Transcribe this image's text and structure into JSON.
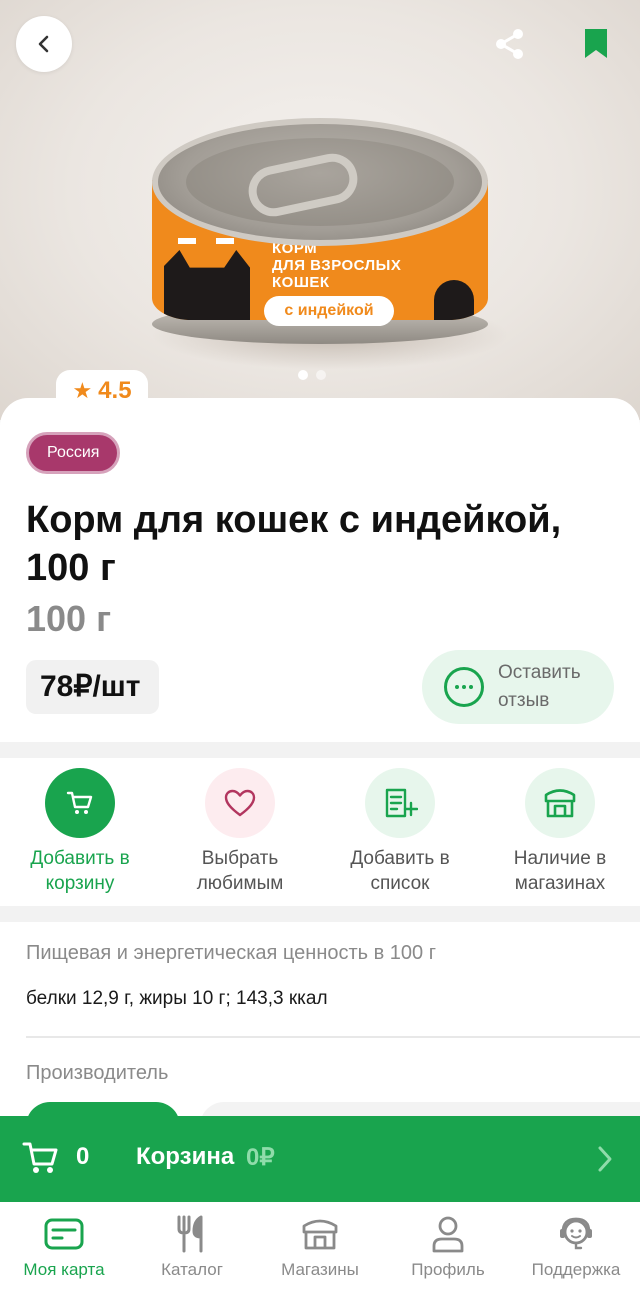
{
  "product": {
    "rating": "4.5",
    "origin_badge": "Россия",
    "title": "Корм для кошек с индейкой, 100 г",
    "weight": "100 г",
    "price": "78₽/шт",
    "review_button": "Оставить отзыв",
    "image_dots": {
      "total": 2,
      "active_index": 0
    }
  },
  "can_label": {
    "lines": [
      "КОРМ",
      "ДЛЯ ВЗРОСЛЫХ",
      "КОШЕК"
    ],
    "pill": "с индейкой"
  },
  "actions": [
    {
      "label": "Добавить в корзину",
      "icon": "cart-icon"
    },
    {
      "label": "Выбрать любимым",
      "icon": "heart-icon"
    },
    {
      "label": "Добавить в список",
      "icon": "list-add-icon"
    },
    {
      "label": "Наличие в магазинах",
      "icon": "store-icon"
    }
  ],
  "nutrition": {
    "title": "Пищевая и энергетическая ценность в 100 г",
    "value": "белки 12,9 г, жиры 10 г; 143,3 ккал"
  },
  "manufacturer": {
    "title": "Производитель"
  },
  "cart": {
    "count": "0",
    "label": "Корзина",
    "total": "0₽"
  },
  "bottom_nav": [
    {
      "label": "Моя карта",
      "icon": "card-icon",
      "active": true
    },
    {
      "label": "Каталог",
      "icon": "cutlery-icon",
      "active": false
    },
    {
      "label": "Магазины",
      "icon": "store-icon",
      "active": false
    },
    {
      "label": "Профиль",
      "icon": "profile-icon",
      "active": false
    },
    {
      "label": "Поддержка",
      "icon": "support-icon",
      "active": false
    }
  ],
  "colors": {
    "accent": "#19a44e",
    "rating": "#f08a1c",
    "badge": "#a8386b"
  }
}
